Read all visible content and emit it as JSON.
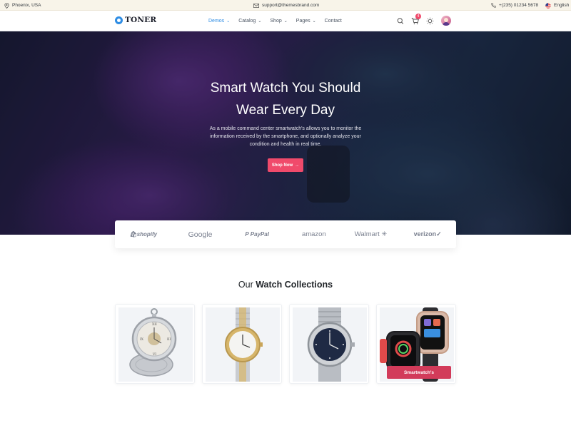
{
  "topbar": {
    "location": "Phoenix, USA",
    "email": "support@themesbrand.com",
    "phone": "+(235) 01234 5678",
    "language": "English"
  },
  "nav": {
    "brand": "TONER",
    "menu": [
      {
        "label": "Demos",
        "active": true
      },
      {
        "label": "Catalog",
        "active": false
      },
      {
        "label": "Shop",
        "active": false
      },
      {
        "label": "Pages",
        "active": false
      },
      {
        "label": "Contact",
        "active": false
      }
    ],
    "cart_count": "4",
    "accent": "#2f8de4"
  },
  "hero": {
    "title_line1": "Smart Watch You Should",
    "title_line2": "Wear Every Day",
    "description": "As a mobile command center smartwatch's allows you to monitor the information received by the smartphone, and optionally analyze your condition and health in real time.",
    "cta": "Shop Now",
    "cta_color": "#f04a6b"
  },
  "brands": [
    "shopify",
    "Google",
    "PayPal",
    "amazon",
    "Walmart",
    "verizon"
  ],
  "collections": {
    "title_prefix": "Our",
    "title_bold": "Watch Collections",
    "cards": [
      {
        "icon": "pocket-watch"
      },
      {
        "icon": "gold-silver-wristwatch"
      },
      {
        "icon": "steel-chronograph-watch"
      },
      {
        "icon": "smartwatch",
        "label": "Smartwatch's"
      }
    ]
  }
}
